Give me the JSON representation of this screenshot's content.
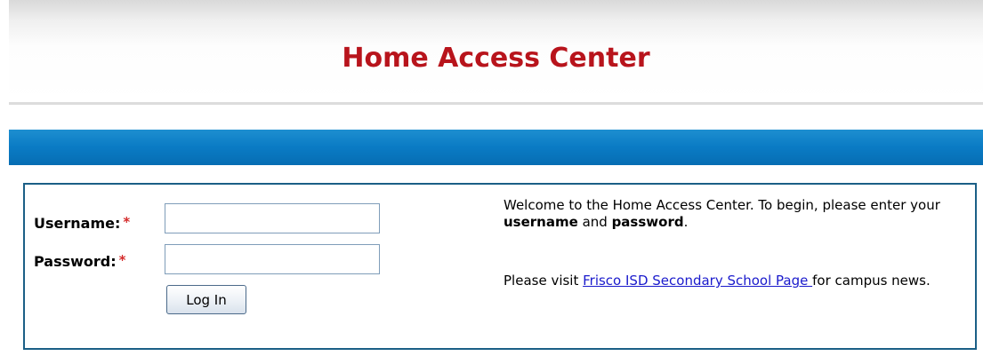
{
  "header": {
    "title": "Home Access Center"
  },
  "login": {
    "username_label": "Username:",
    "password_label": "Password:",
    "required_marker": "*",
    "username_value": "",
    "password_value": "",
    "login_button": "Log In"
  },
  "welcome": {
    "text_start": "Welcome to the Home Access Center. To begin, please enter your ",
    "username_word": "username",
    "text_and": " and ",
    "password_word": "password",
    "text_end": "."
  },
  "visit": {
    "text_start": "Please visit ",
    "link_text": "Frisco ISD Secondary School Page ",
    "text_end": "for campus news."
  },
  "colors": {
    "title": "#b8141c",
    "blue_bar": "#0a7bc4",
    "box_border": "#1b5f86",
    "required": "#d42b2b",
    "link": "#1a1acc"
  }
}
